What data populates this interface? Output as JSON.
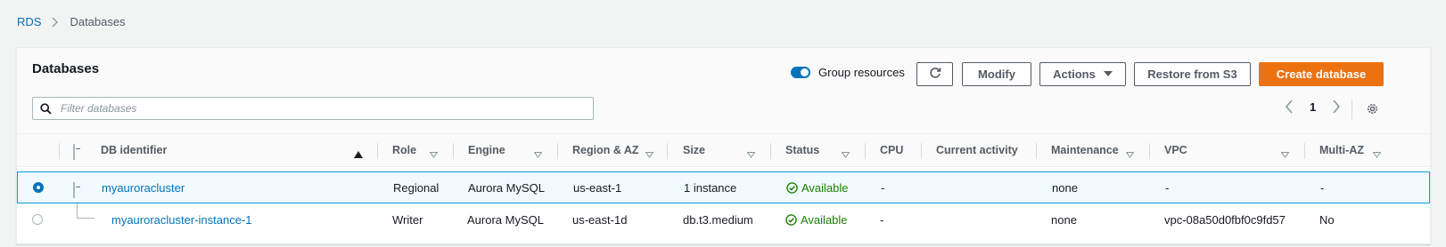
{
  "breadcrumb": {
    "root": "RDS",
    "current": "Databases"
  },
  "panel": {
    "title": "Databases",
    "group_toggle_label": "Group resources",
    "group_toggle_on": true,
    "buttons": {
      "refresh_icon": "refresh-icon",
      "modify": "Modify",
      "actions": "Actions",
      "restore": "Restore from S3",
      "create": "Create database"
    },
    "search_placeholder": "Filter databases",
    "page": "1"
  },
  "columns": {
    "db_identifier": "DB identifier",
    "role": "Role",
    "engine": "Engine",
    "region": "Region & AZ",
    "size": "Size",
    "status": "Status",
    "cpu": "CPU",
    "activity": "Current activity",
    "maintenance": "Maintenance",
    "vpc": "VPC",
    "multiaz": "Multi-AZ"
  },
  "rows": [
    {
      "id": "myauroracluster",
      "role": "Regional",
      "engine": "Aurora MySQL",
      "region": "us-east-1",
      "size": "1 instance",
      "status": "Available",
      "cpu": "-",
      "activity": "",
      "maintenance": "none",
      "vpc": "-",
      "multiaz": "-",
      "selected": true
    },
    {
      "id": "myauroracluster-instance-1",
      "role": "Writer",
      "engine": "Aurora MySQL",
      "region": "us-east-1d",
      "size": "db.t3.medium",
      "status": "Available",
      "cpu": "-",
      "activity": "",
      "maintenance": "none",
      "vpc": "vpc-08a50d0fbf0c9fd57",
      "multiaz": "No",
      "selected": false
    }
  ],
  "colors": {
    "accent": "#0073bb",
    "primary_button": "#ec7211",
    "status_ok": "#1d8102",
    "selected_row": "#f1faff"
  }
}
